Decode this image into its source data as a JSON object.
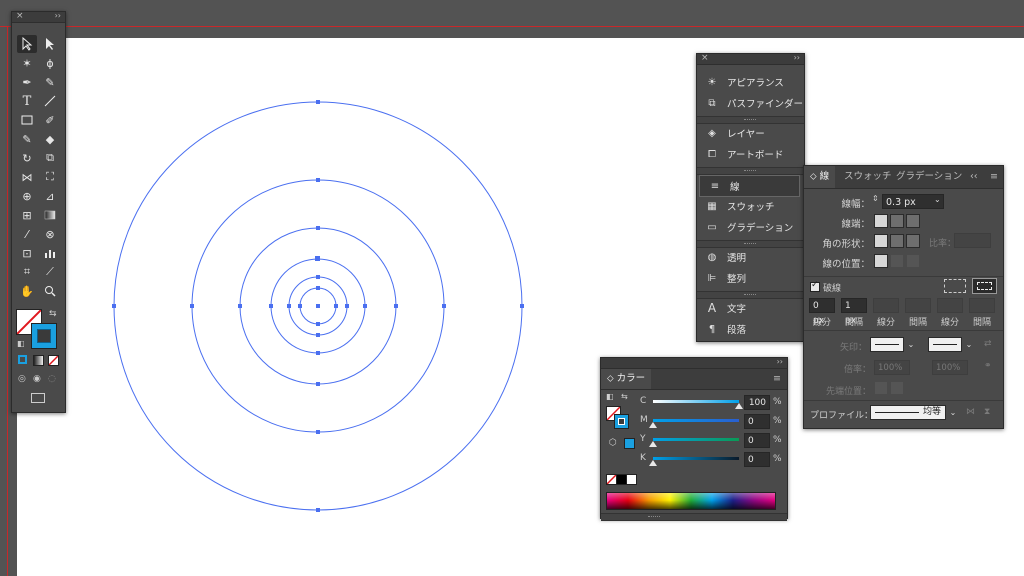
{
  "toolbox": {
    "close_glyph": "×",
    "collapse_glyph": "››"
  },
  "dock": {
    "items": [
      {
        "label": "アピアランス",
        "icon": "appearance-icon"
      },
      {
        "label": "パスファインダー",
        "icon": "pathfinder-icon"
      },
      {
        "label": "レイヤー",
        "icon": "layers-icon"
      },
      {
        "label": "アートボード",
        "icon": "artboards-icon"
      },
      {
        "label": "線",
        "icon": "stroke-icon"
      },
      {
        "label": "スウォッチ",
        "icon": "swatches-icon"
      },
      {
        "label": "グラデーション",
        "icon": "gradient-icon"
      },
      {
        "label": "透明",
        "icon": "transparency-icon"
      },
      {
        "label": "整列",
        "icon": "align-icon"
      },
      {
        "label": "文字",
        "icon": "character-icon"
      },
      {
        "label": "段落",
        "icon": "paragraph-icon"
      }
    ]
  },
  "stroke_panel": {
    "tabs": [
      "線",
      "スウォッチ",
      "グラデーション"
    ],
    "collapse_glyph": "‹‹",
    "menu_glyph": "≡",
    "weight_label": "線幅：",
    "weight_value": "0.3 px",
    "cap_label": "線端：",
    "corner_label": "角の形状：",
    "limit_label": "比率：",
    "align_label": "線の位置：",
    "dashed_label": "破線",
    "dashed_checked": true,
    "dash_values": [
      "0 px",
      "1 px",
      "",
      "",
      "",
      ""
    ],
    "dash_labels": [
      "線分",
      "間隔",
      "線分",
      "間隔",
      "線分",
      "間隔"
    ],
    "arrow_label": "矢印：",
    "scale_label": "倍率：",
    "scale_values": [
      "100%",
      "100%"
    ],
    "tip_label": "先端位置：",
    "profile_label": "プロファイル：",
    "profile_value": "均等"
  },
  "color_panel": {
    "title": "カラー",
    "menu_glyph": "≡",
    "channels": [
      {
        "name": "C",
        "value": "100",
        "unit": "%",
        "fraction": 1.0
      },
      {
        "name": "M",
        "value": "0",
        "unit": "%",
        "fraction": 0.0
      },
      {
        "name": "Y",
        "value": "0",
        "unit": "%",
        "fraction": 0.0
      },
      {
        "name": "K",
        "value": "0",
        "unit": "%",
        "fraction": 0.0
      }
    ],
    "stroke_color": "#1aa0e0"
  },
  "colors": {
    "path_blue": "#4a6ff0",
    "bleed_red": "#c8282a",
    "artboard": "#ffffff"
  }
}
